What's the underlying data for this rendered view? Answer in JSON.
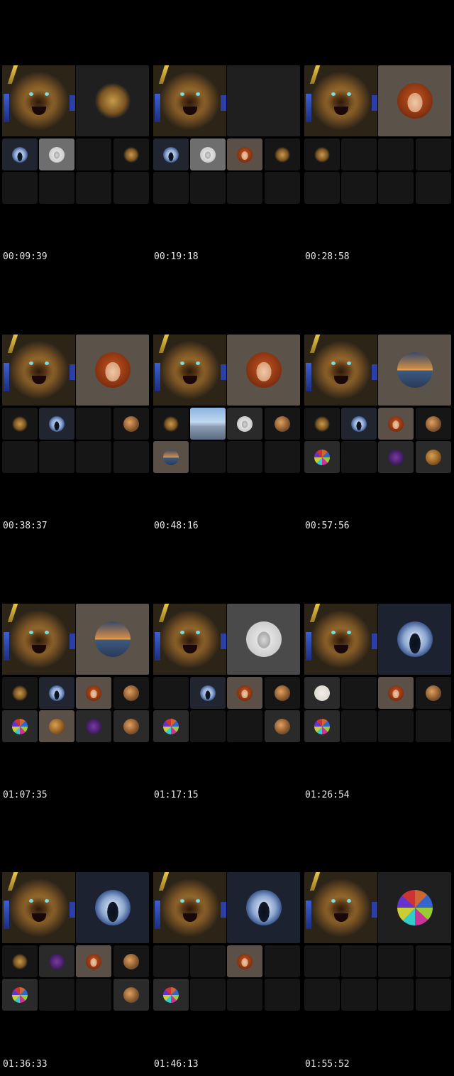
{
  "frames": [
    {
      "timestamp": "00:09:39"
    },
    {
      "timestamp": "00:19:18"
    },
    {
      "timestamp": "00:28:58"
    },
    {
      "timestamp": "00:38:37"
    },
    {
      "timestamp": "00:48:16"
    },
    {
      "timestamp": "00:57:56"
    },
    {
      "timestamp": "01:07:35"
    },
    {
      "timestamp": "01:17:15"
    },
    {
      "timestamp": "01:26:54"
    },
    {
      "timestamp": "01:36:33"
    },
    {
      "timestamp": "01:46:13"
    },
    {
      "timestamp": "01:55:52"
    }
  ]
}
